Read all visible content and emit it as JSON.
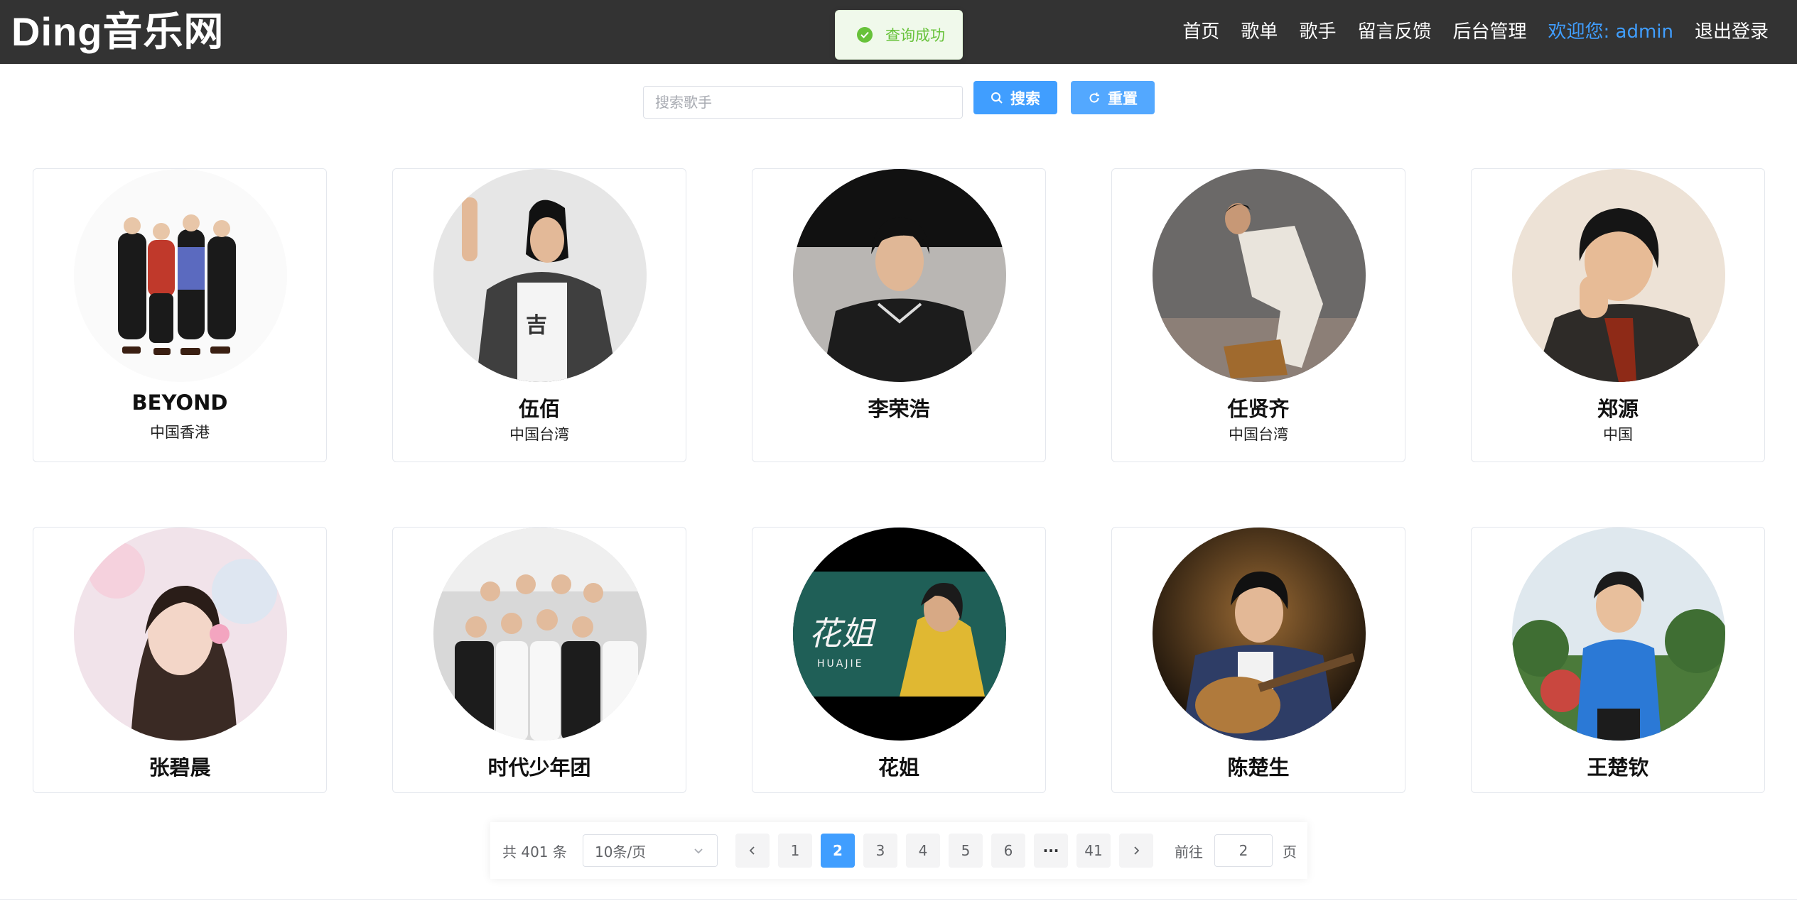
{
  "header": {
    "logo": "Ding音乐网",
    "nav": [
      {
        "label": "首页"
      },
      {
        "label": "歌单"
      },
      {
        "label": "歌手"
      },
      {
        "label": "留言反馈"
      },
      {
        "label": "后台管理"
      }
    ],
    "welcome": "欢迎您: admin",
    "logout": "退出登录"
  },
  "toast": {
    "text": "查询成功",
    "icon": "check-circle-icon",
    "color": "#67c23a"
  },
  "search": {
    "placeholder": "搜索歌手",
    "value": "",
    "search_label": "搜索",
    "reset_label": "重置"
  },
  "artists": [
    {
      "name": "BEYOND",
      "region": "中国香港"
    },
    {
      "name": "伍佰",
      "region": "中国台湾"
    },
    {
      "name": "李荣浩",
      "region": ""
    },
    {
      "name": "任贤齐",
      "region": "中国台湾"
    },
    {
      "name": "郑源",
      "region": "中国"
    },
    {
      "name": "张碧晨",
      "region": ""
    },
    {
      "name": "时代少年团",
      "region": ""
    },
    {
      "name": "花姐",
      "region": ""
    },
    {
      "name": "陈楚生",
      "region": ""
    },
    {
      "name": "王楚钦",
      "region": ""
    }
  ],
  "pagination": {
    "total": "共 401 条",
    "page_size": "10条/页",
    "pages": [
      "1",
      "2",
      "3",
      "4",
      "5",
      "6",
      "···",
      "41"
    ],
    "current": "2",
    "goto_label": "前往",
    "goto_value": "2",
    "page_suffix": "页"
  },
  "colors": {
    "primary": "#409eff",
    "header_bg": "#333333",
    "success": "#67c23a"
  }
}
